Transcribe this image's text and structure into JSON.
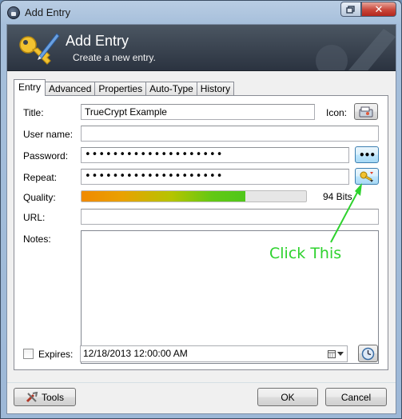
{
  "window": {
    "title": "Add Entry",
    "icons": {
      "app": "keepass-lock-icon",
      "restore": "restore-icon",
      "close": "close-icon"
    },
    "close_glyph": "✕"
  },
  "banner": {
    "title": "Add Entry",
    "subtitle": "Create a new entry.",
    "icon": "key-pen-icon"
  },
  "tabs": [
    {
      "label": "Entry",
      "active": true
    },
    {
      "label": "Advanced",
      "active": false
    },
    {
      "label": "Properties",
      "active": false
    },
    {
      "label": "Auto-Type",
      "active": false
    },
    {
      "label": "History",
      "active": false
    }
  ],
  "entry": {
    "title_label": "Title:",
    "title_value": "TrueCrypt Example",
    "icon_label": "Icon:",
    "username_label": "User name:",
    "username_value": "",
    "password_label": "Password:",
    "password_value": "••••••••••••••••••••",
    "repeat_label": "Repeat:",
    "repeat_value": "••••••••••••••••••••",
    "show_password_glyph": "•••",
    "quality_label": "Quality:",
    "quality_fraction": 0.73,
    "quality_text": "94 Bits",
    "url_label": "URL:",
    "url_value": "",
    "notes_label": "Notes:",
    "notes_value": "",
    "expires_label": "Expires:",
    "expires_checked": false,
    "expires_value": "12/18/2013 12:00:00 AM"
  },
  "annotation": {
    "text": "Click This",
    "color": "#2ed22e"
  },
  "footer": {
    "tools_label": "Tools",
    "ok_label": "OK",
    "cancel_label": "Cancel"
  },
  "colors": {
    "banner_bg": "#2b3340",
    "quality_start": "#f08a00",
    "quality_end": "#4fc71a"
  }
}
